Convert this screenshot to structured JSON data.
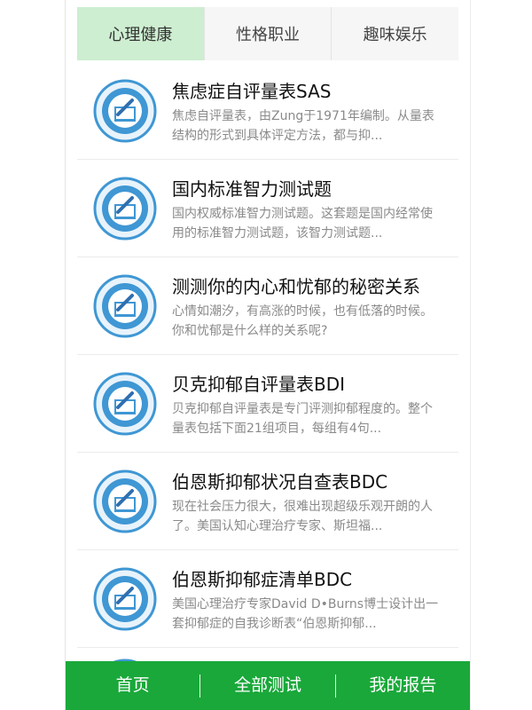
{
  "tabs": [
    {
      "label": "心理健康",
      "active": true
    },
    {
      "label": "性格职业",
      "active": false
    },
    {
      "label": "趣味娱乐",
      "active": false
    }
  ],
  "items": [
    {
      "title": "焦虑症自评量表SAS",
      "desc": "焦虑自评量表，由Zung于1971年编制。从量表结构的形式到具体评定方法，都与抑..."
    },
    {
      "title": "国内标准智力测试题",
      "desc": "国内权威标准智力测试题。这套题是国内经常使用的标准智力测试题，该智力测试题..."
    },
    {
      "title": "测测你的内心和忧郁的秘密关系",
      "desc": "心情如潮汐，有高涨的时候，也有低落的时候。你和忧郁是什么样的关系呢?"
    },
    {
      "title": "贝克抑郁自评量表BDI",
      "desc": "贝克抑郁自评量表是专门评测抑郁程度的。整个量表包括下面21组项目，每组有4句..."
    },
    {
      "title": "伯恩斯抑郁状况自查表BDC",
      "desc": "现在社会压力很大，很难出现超级乐观开朗的人了。美国认知心理治疗专家、斯坦福..."
    },
    {
      "title": "伯恩斯抑郁症清单BDC",
      "desc": "美国心理治疗专家David D•Burns博士设计出一套抑郁症的自我诊断表“伯恩斯抑郁..."
    }
  ],
  "icon": {
    "name": "test-badge-icon",
    "ring_color": "#3f97d4",
    "inner_color": "#ffffff"
  },
  "bottom_nav": [
    {
      "label": "首页"
    },
    {
      "label": "全部测试"
    },
    {
      "label": "我的报告"
    }
  ],
  "colors": {
    "accent": "#1aa83a",
    "active_tab": "#cdeed0"
  }
}
